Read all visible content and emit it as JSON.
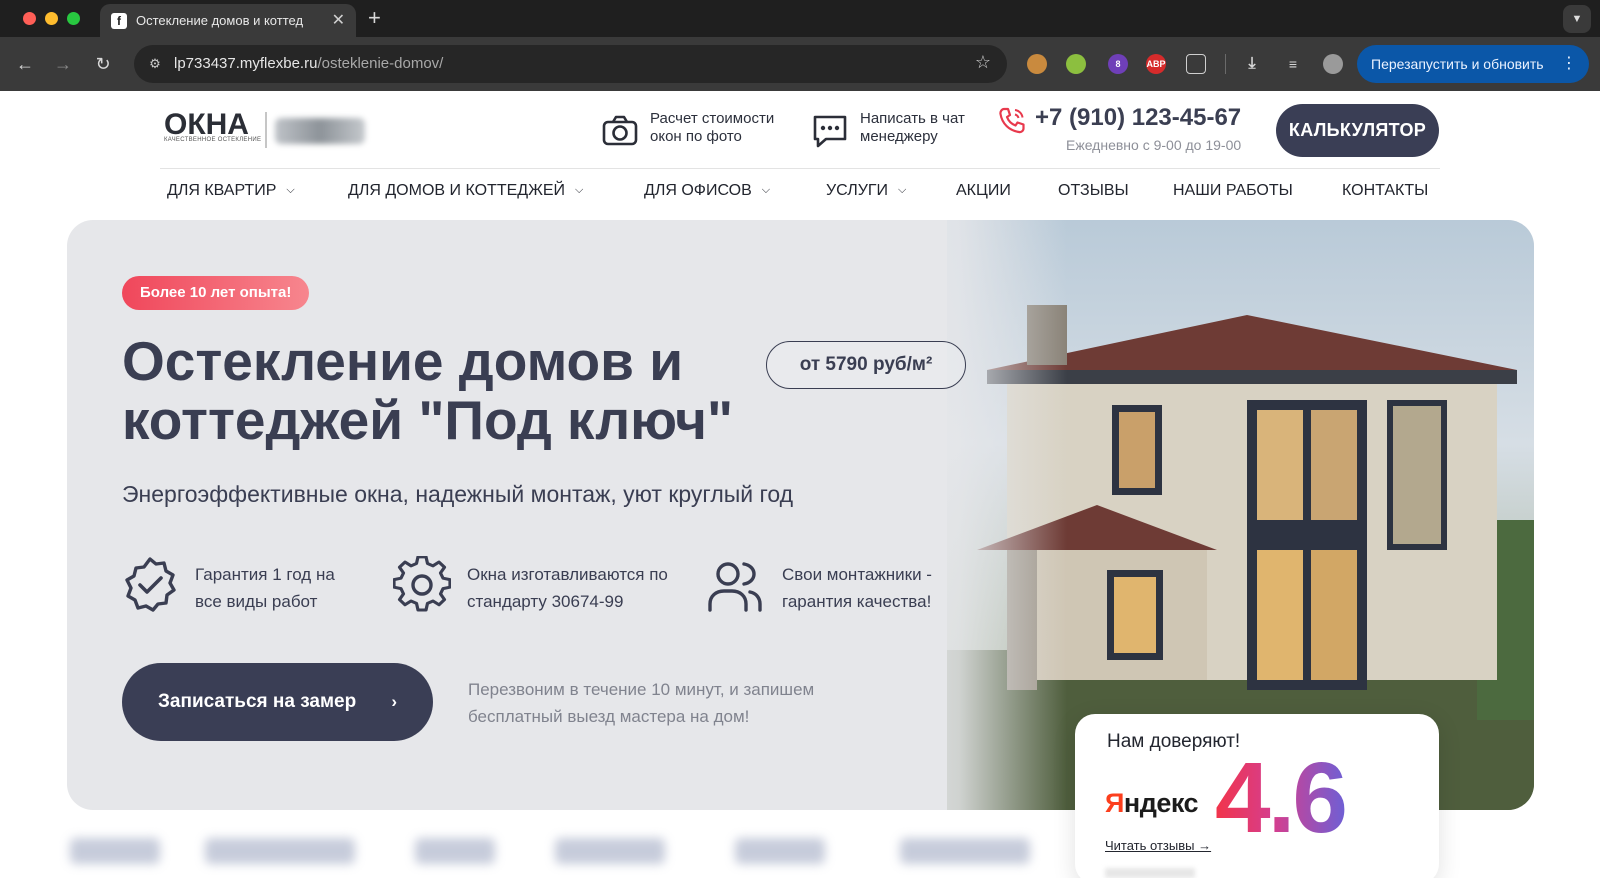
{
  "browser": {
    "tab_title": "Остекление домов и коттед",
    "tab_favicon": "f",
    "url_host": "lp733437.myflexbe.ru",
    "url_path": "/osteklenie-domov/",
    "relaunch_label": "Перезапустить и обновить",
    "extension_badge": "8",
    "extension_abp": "ABP"
  },
  "header": {
    "logo": "ОКНА",
    "logo_tagline": "КАЧЕСТВЕННОЕ ОСТЕКЛЕНИЕ",
    "photo_calc": "Расчет стоимости окон по фото",
    "chat_manager": "Написать в чат менеджеру",
    "phone": "+7 (910) 123-45-67",
    "hours": "Ежедневно с 9-00 до 19-00",
    "calculator_button": "КАЛЬКУЛЯТОР"
  },
  "nav": {
    "items": [
      {
        "label": "ДЛЯ КВАРТИР"
      },
      {
        "label": "ДЛЯ ДОМОВ И КОТТЕДЖЕЙ"
      },
      {
        "label": "ДЛЯ ОФИСОВ"
      },
      {
        "label": "УСЛУГИ"
      },
      {
        "label": "АКЦИИ"
      },
      {
        "label": "ОТЗЫВЫ"
      },
      {
        "label": "НАШИ РАБОТЫ"
      },
      {
        "label": "КОНТАКТЫ"
      }
    ]
  },
  "hero": {
    "badge": "Более 10 лет опыта!",
    "title": "Остекление домов и коттеджей \"Под ключ\"",
    "price": "от 5790 руб/м²",
    "subtitle": "Энергоэффективные окна, надежный монтаж, уют круглый год",
    "features": [
      {
        "text": "Гарантия 1 год на все виды работ",
        "icon": "badge-check-icon"
      },
      {
        "text": "Окна изготавливаются по стандарту 30674-99",
        "icon": "gear-icon"
      },
      {
        "text": "Свои монтажники - гарантия качества!",
        "icon": "users-icon"
      }
    ],
    "cta": "Записаться на замер",
    "callback": "Перезвоним в течение 10 минут, и запишем бесплатный выезд мастера на дом!"
  },
  "trust": {
    "title": "Нам доверяют!",
    "brand_first": "Я",
    "brand_rest": "ндекс",
    "rating": "4.6",
    "read_reviews": "Читать отзывы →"
  },
  "colors": {
    "primary": "#3a3e55",
    "badge_start": "#f0475b",
    "badge_end": "#f7868e",
    "phone_icon": "#e8394d",
    "hero_bg": "#e6e7ea"
  }
}
